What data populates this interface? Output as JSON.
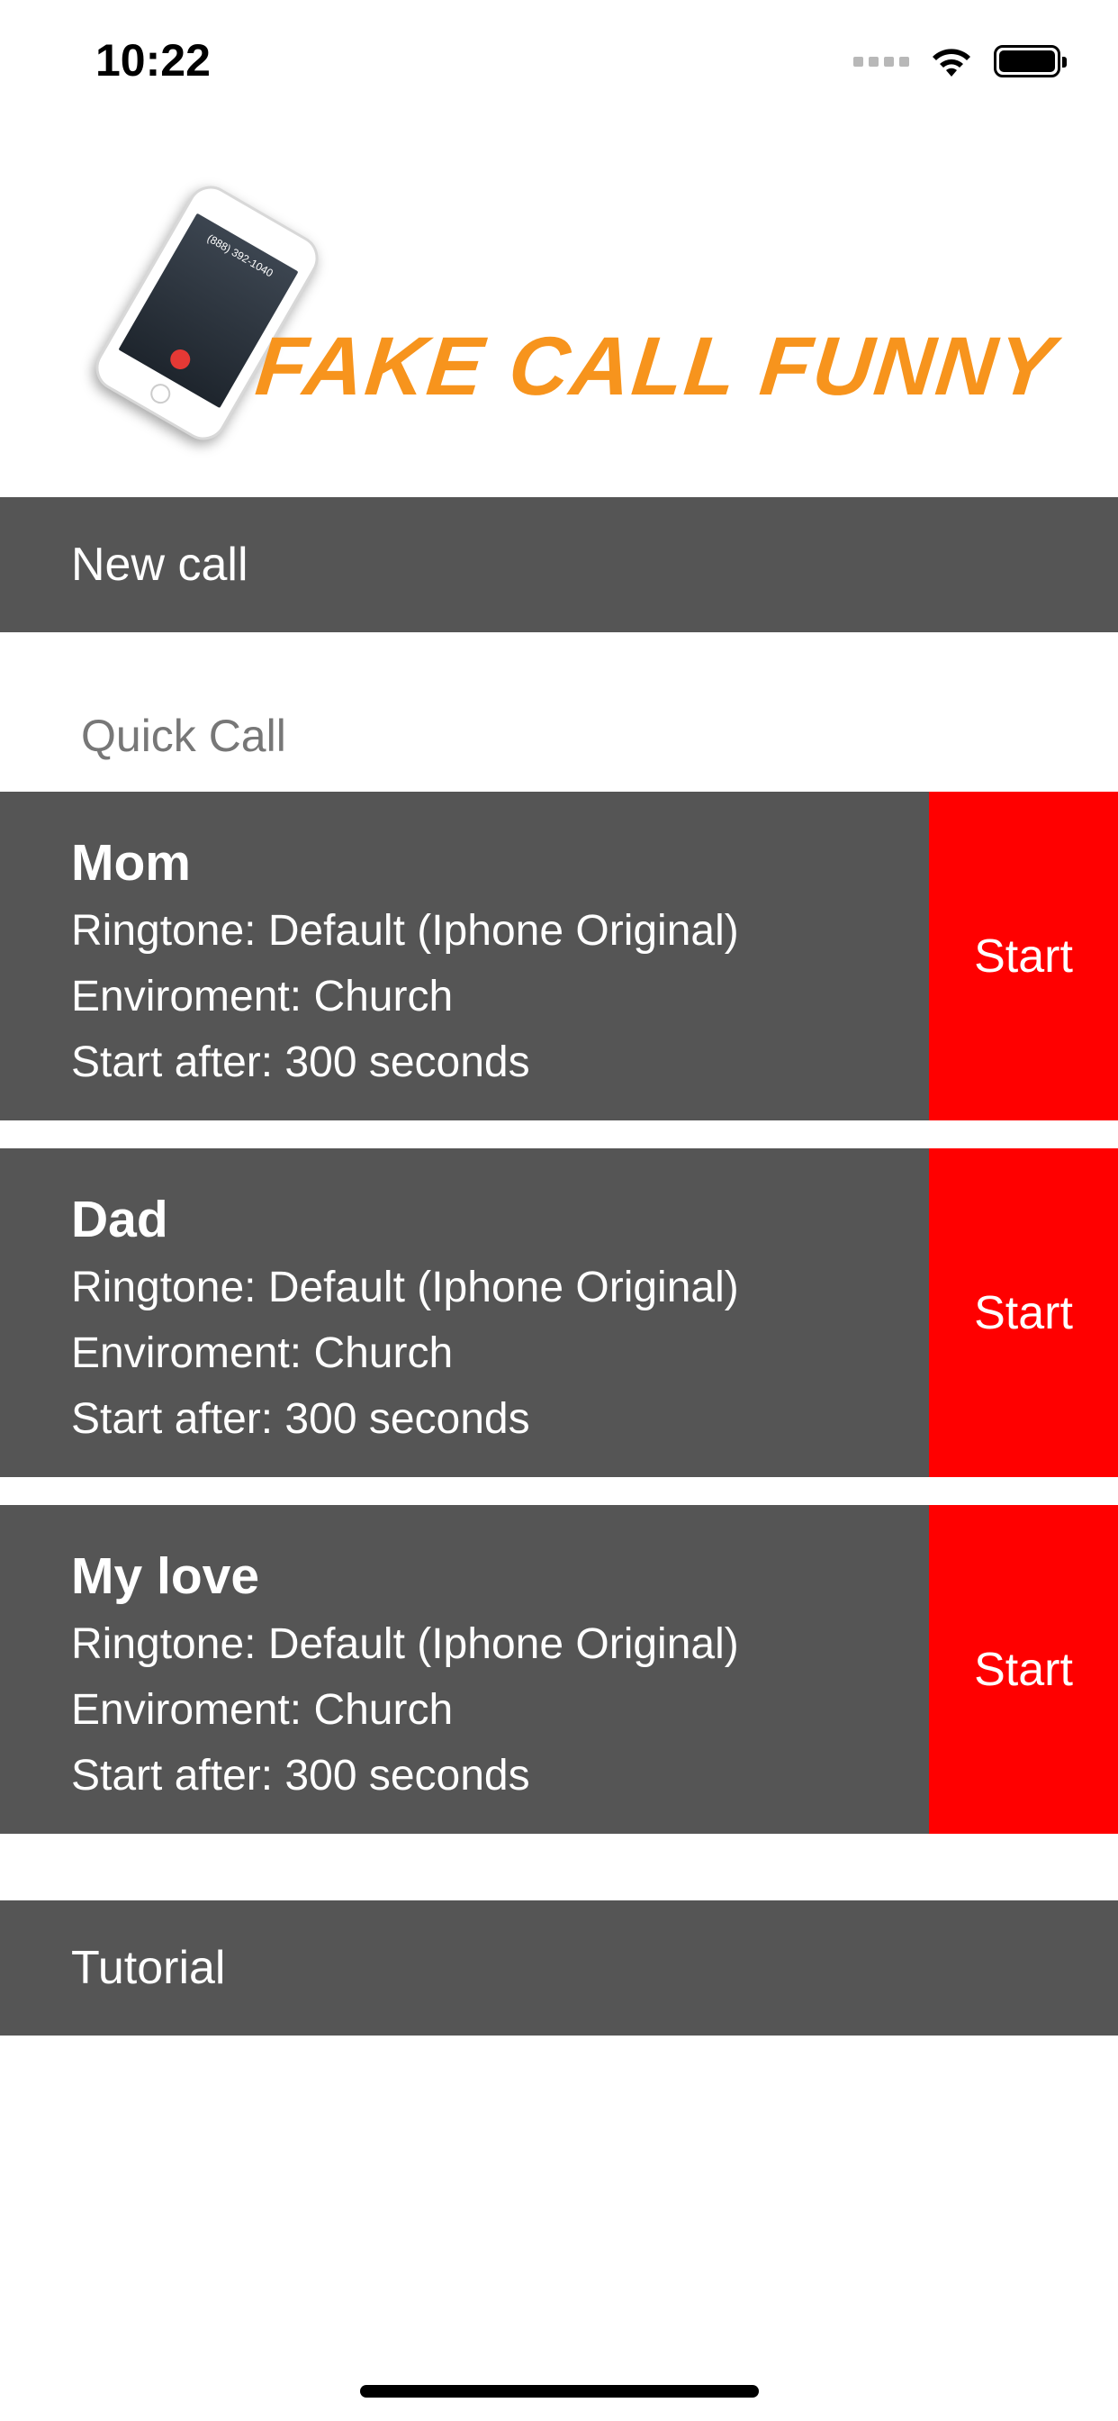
{
  "status_bar": {
    "time": "10:22",
    "icons": [
      "cellular-signal-icon",
      "wifi-icon",
      "battery-icon"
    ]
  },
  "logo": {
    "text": "FAKE CALL FUNNY",
    "phone_screen_number": "(888) 392-1040",
    "text_color": "#f7941d"
  },
  "menu": {
    "new_call": "New call",
    "tutorial": "Tutorial"
  },
  "quick_call": {
    "section_label": "Quick Call",
    "items": [
      {
        "name": "Mom",
        "ringtone": "Ringtone: Default (Iphone Original)",
        "environment": "Enviroment: Church",
        "delay": "Start after: 300 seconds",
        "start_label": "Start"
      },
      {
        "name": "Dad",
        "ringtone": "Ringtone: Default (Iphone Original)",
        "environment": "Enviroment: Church",
        "delay": "Start after: 300 seconds",
        "start_label": "Start"
      },
      {
        "name": "My love",
        "ringtone": "Ringtone: Default (Iphone Original)",
        "environment": "Enviroment: Church",
        "delay": "Start after: 300 seconds",
        "start_label": "Start"
      }
    ]
  },
  "colors": {
    "bar_background": "#555555",
    "start_button": "#ff0000",
    "section_label": "#777777"
  }
}
